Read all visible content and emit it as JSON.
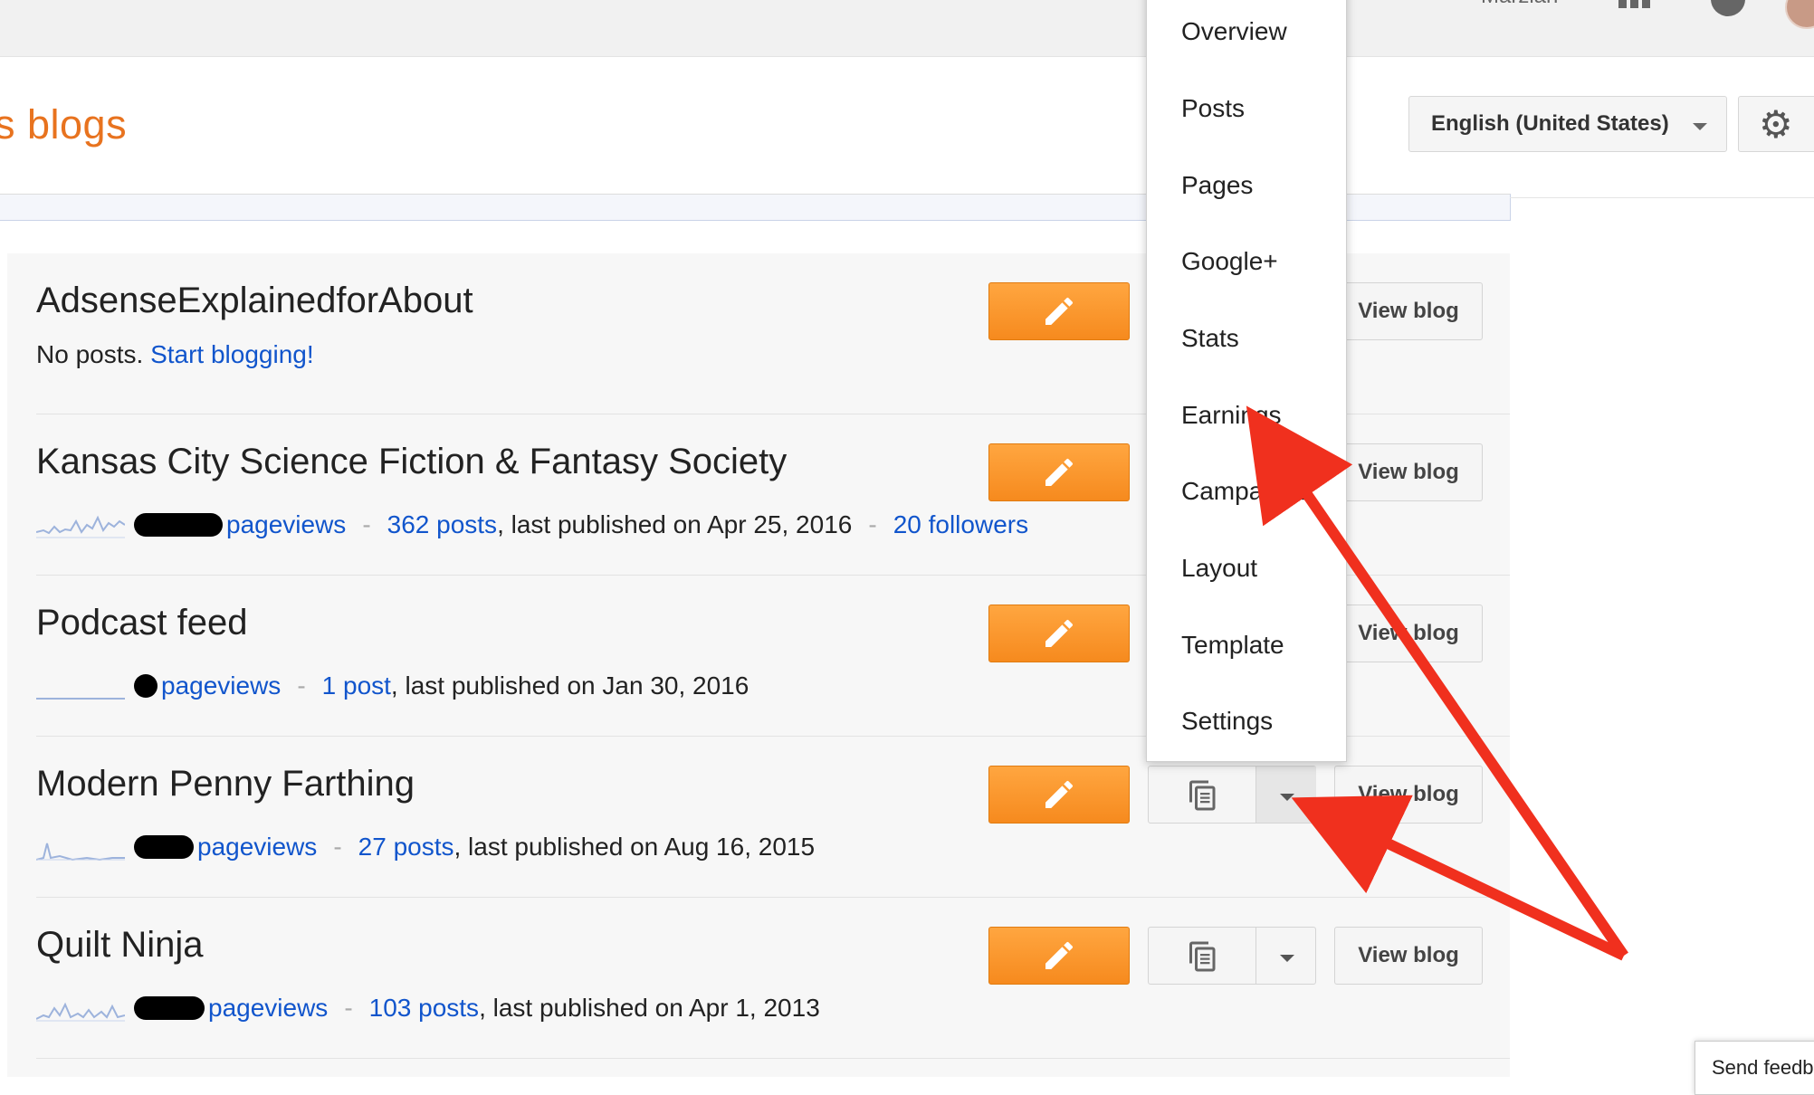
{
  "topbar": {
    "user_name": "Marzian"
  },
  "header": {
    "title": "s blogs",
    "language": "English (United States)"
  },
  "blogs": [
    {
      "name": "AdsenseExplainedforAbout",
      "no_posts": "No posts.",
      "start_link": "Start blogging!",
      "view_label": "View blog"
    },
    {
      "name": "Kansas City Science Fiction & Fantasy Society",
      "pageviews": "pageviews",
      "posts": "362 posts",
      "last_published": ", last published on Apr 25, 2016",
      "followers": "20 followers",
      "view_label": "View blog"
    },
    {
      "name": "Podcast feed",
      "pageviews": "pageviews",
      "posts": "1 post",
      "last_published": ", last published on Jan 30, 2016",
      "view_label": "View blog"
    },
    {
      "name": "Modern Penny Farthing",
      "pageviews": "pageviews",
      "posts": "27 posts",
      "last_published": ", last published on Aug 16, 2015",
      "view_label": "View blog"
    },
    {
      "name": "Quilt Ninja",
      "pageviews": "pageviews",
      "posts": "103 posts",
      "last_published": ", last published on Apr 1, 2013",
      "view_label": "View blog"
    }
  ],
  "separator": "-",
  "menu": {
    "items": [
      "Overview",
      "Posts",
      "Pages",
      "Google+",
      "Stats",
      "Earnings",
      "Campaigns",
      "Layout",
      "Template",
      "Settings"
    ]
  },
  "feedback": {
    "label": "Send feedback"
  },
  "colors": {
    "accent": "#e8731f",
    "link": "#1155cc",
    "edit_button": "#f68a1e",
    "arrow": "#f0301e"
  },
  "icons": [
    "apps-grid-icon",
    "notifications-icon",
    "gear-icon",
    "pencil-icon",
    "document-icon",
    "chevron-down-icon"
  ]
}
